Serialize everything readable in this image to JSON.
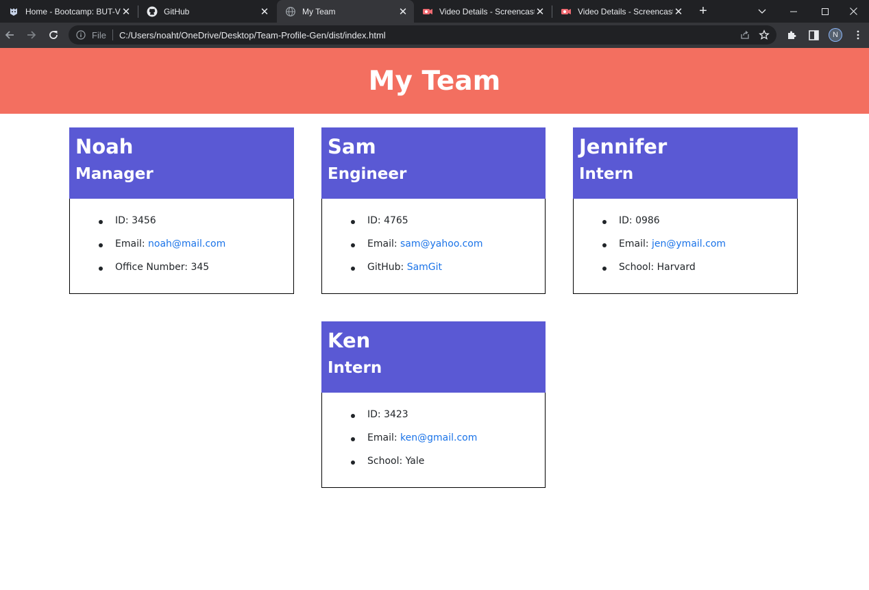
{
  "browser": {
    "tabs": [
      {
        "title": "Home - Bootcamp: BUT-V",
        "icon": "bootcamp-logo-icon"
      },
      {
        "title": "GitHub",
        "icon": "github-icon"
      },
      {
        "title": "My Team",
        "icon": "globe-icon"
      },
      {
        "title": "Video Details - Screencast",
        "icon": "screencastify-icon"
      },
      {
        "title": "Video Details - Screencast",
        "icon": "screencastify-icon"
      }
    ],
    "active_tab": 2,
    "address": {
      "scheme_label": "File",
      "url": "C:/Users/noaht/OneDrive/Desktop/Team-Profile-Gen/dist/index.html"
    },
    "profile_initial": "N"
  },
  "page": {
    "title": "My Team",
    "header_color": "#f36f60",
    "card_header_color": "#5a59d4",
    "link_color": "#1a73e8"
  },
  "cards": [
    {
      "name": "Noah",
      "role": "Manager",
      "id_label": "ID: 3456",
      "email_label": "Email: ",
      "email": "noah@mail.com",
      "extra_label": "Office Number: 345",
      "extra_link": ""
    },
    {
      "name": "Sam",
      "role": "Engineer",
      "id_label": "ID: 4765",
      "email_label": "Email: ",
      "email": "sam@yahoo.com",
      "extra_label": "GitHub: ",
      "extra_link": "SamGit"
    },
    {
      "name": "Jennifer",
      "role": "Intern",
      "id_label": "ID: 0986",
      "email_label": "Email: ",
      "email": "jen@ymail.com",
      "extra_label": "School: Harvard",
      "extra_link": ""
    },
    {
      "name": "Ken",
      "role": "Intern",
      "id_label": "ID: 3423",
      "email_label": "Email: ",
      "email": "ken@gmail.com",
      "extra_label": "School: Yale",
      "extra_link": ""
    }
  ]
}
